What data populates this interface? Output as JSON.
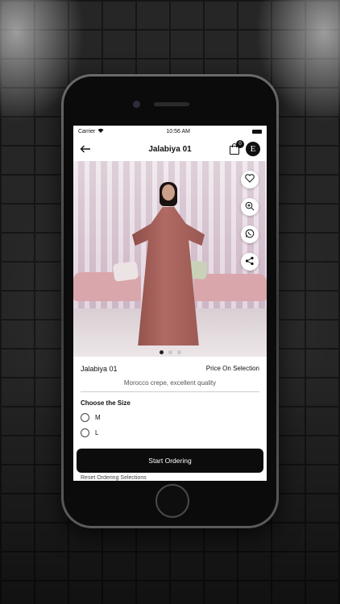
{
  "status_bar": {
    "carrier": "Carrier",
    "time": "10:56 AM"
  },
  "nav": {
    "title": "Jalabiya 01",
    "cart_count": "0",
    "logo_letter": "E"
  },
  "product": {
    "name": "Jalabiya 01",
    "price": "Price On Selection",
    "description": "Morocco crepe, excellent quality",
    "image_pages": 3,
    "active_page": 1
  },
  "sizes": {
    "title": "Choose the Size",
    "options": [
      "M",
      "L"
    ]
  },
  "actions": {
    "start_ordering": "Start Ordering",
    "reset_selection": "Reset Ordering Selections"
  },
  "icons": {
    "favorite": "heart-icon",
    "zoom": "zoom-in-icon",
    "whatsapp": "whatsapp-icon",
    "share": "share-icon"
  }
}
